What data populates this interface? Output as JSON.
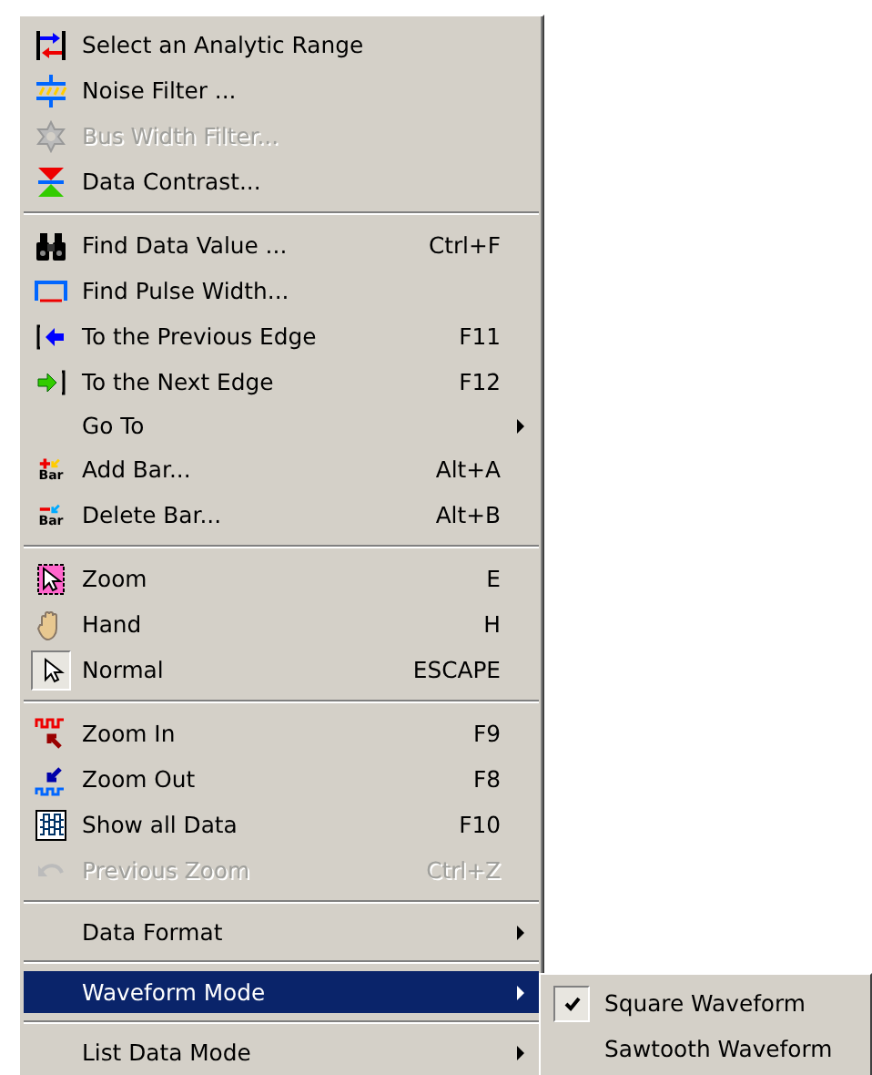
{
  "menu": {
    "items": [
      {
        "kind": "item",
        "label": "Select an Analytic Range",
        "disabled": false
      },
      {
        "kind": "item",
        "label": "Noise Filter ...",
        "disabled": false
      },
      {
        "kind": "item",
        "label": "Bus Width Filter...",
        "disabled": true
      },
      {
        "kind": "item",
        "label": "Data Contrast...",
        "disabled": false
      },
      {
        "kind": "separator"
      },
      {
        "kind": "item",
        "label": "Find Data Value ...",
        "shortcut": "Ctrl+F",
        "disabled": false
      },
      {
        "kind": "item",
        "label": "Find Pulse Width...",
        "disabled": false
      },
      {
        "kind": "item",
        "label": "To the Previous Edge",
        "shortcut": "F11",
        "disabled": false
      },
      {
        "kind": "item",
        "label": "To the Next Edge",
        "shortcut": "F12",
        "disabled": false
      },
      {
        "kind": "item",
        "label": "Go To",
        "submenu": true,
        "disabled": false
      },
      {
        "kind": "item",
        "label": "Add Bar...",
        "shortcut": "Alt+A",
        "icon_text": "Bar",
        "disabled": false
      },
      {
        "kind": "item",
        "label": "Delete Bar...",
        "shortcut": "Alt+B",
        "icon_text": "Bar",
        "disabled": false
      },
      {
        "kind": "separator"
      },
      {
        "kind": "item",
        "label": "Zoom",
        "shortcut": "E",
        "checked": false,
        "disabled": false
      },
      {
        "kind": "item",
        "label": "Hand",
        "shortcut": "H",
        "checked": false,
        "disabled": false
      },
      {
        "kind": "item",
        "label": "Normal",
        "shortcut": "ESCAPE",
        "checked": true,
        "disabled": false
      },
      {
        "kind": "separator"
      },
      {
        "kind": "item",
        "label": "Zoom In",
        "shortcut": "F9",
        "disabled": false
      },
      {
        "kind": "item",
        "label": "Zoom Out",
        "shortcut": "F8",
        "disabled": false
      },
      {
        "kind": "item",
        "label": "Show all Data",
        "shortcut": "F10",
        "disabled": false
      },
      {
        "kind": "item",
        "label": "Previous Zoom",
        "shortcut": "Ctrl+Z",
        "disabled": true
      },
      {
        "kind": "separator"
      },
      {
        "kind": "item",
        "label": "Data Format",
        "submenu": true,
        "disabled": false
      },
      {
        "kind": "separator"
      },
      {
        "kind": "item",
        "label": "Waveform Mode",
        "submenu": true,
        "selected": true,
        "disabled": false
      },
      {
        "kind": "separator"
      },
      {
        "kind": "item",
        "label": "List Data Mode",
        "submenu": true,
        "selected": false,
        "disabled": false
      }
    ]
  },
  "submenu": {
    "items": [
      {
        "label": "Square Waveform",
        "checked": true
      },
      {
        "label": "Sawtooth Waveform",
        "checked": false
      }
    ]
  }
}
